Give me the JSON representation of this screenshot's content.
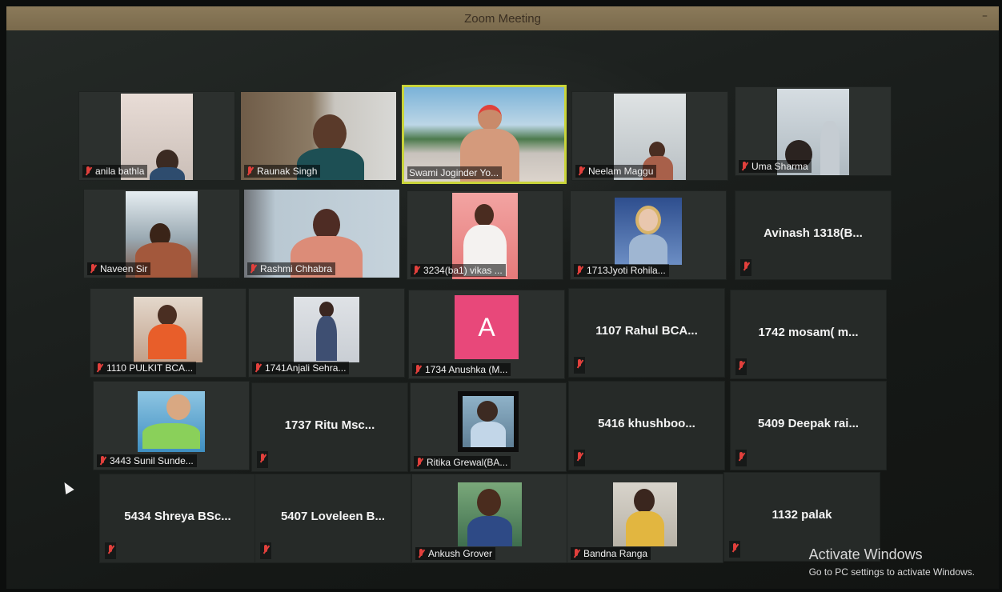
{
  "window": {
    "title": "Zoom Meeting",
    "minimize_glyph": "–"
  },
  "participants": [
    {
      "name": "anila bathla"
    },
    {
      "name": "Raunak Singh"
    },
    {
      "name": "Swami Joginder Yo..."
    },
    {
      "name": "Neelam Maggu"
    },
    {
      "name": "Uma Sharma"
    },
    {
      "name": "Naveen Sir"
    },
    {
      "name": "Rashmi Chhabra"
    },
    {
      "name": "3234(ba1) vikas ..."
    },
    {
      "name": "1713Jyoti Rohila..."
    },
    {
      "name": "Avinash 1318(B..."
    },
    {
      "name": "1110 PULKIT BCA..."
    },
    {
      "name": "1741Anjali Sehra..."
    },
    {
      "name": "1734 Anushka (M..."
    },
    {
      "name": "1107 Rahul BCA..."
    },
    {
      "name": "1742 mosam( m..."
    },
    {
      "name": "3443 Sunil Sunde..."
    },
    {
      "name": "1737 Ritu Msc..."
    },
    {
      "name": "Ritika Grewal(BA..."
    },
    {
      "name": "5416 khushboo..."
    },
    {
      "name": "5409 Deepak rai..."
    },
    {
      "name": "5434 Shreya BSc..."
    },
    {
      "name": "5407 Loveleen B..."
    },
    {
      "name": "Ankush Grover"
    },
    {
      "name": "Bandna Ranga"
    },
    {
      "name": "1132 palak"
    }
  ],
  "avatar_letter": "A",
  "icons": {
    "mic": "muted-mic-icon",
    "cursor": "mouse-pointer-icon"
  },
  "colors": {
    "active_speaker_border": "#c9d43a",
    "muted_mic": "#e2403c",
    "avatar_bg": "#e8487a"
  },
  "watermark": {
    "title": "Activate Windows",
    "subtitle": "Go to PC settings to activate Windows."
  }
}
